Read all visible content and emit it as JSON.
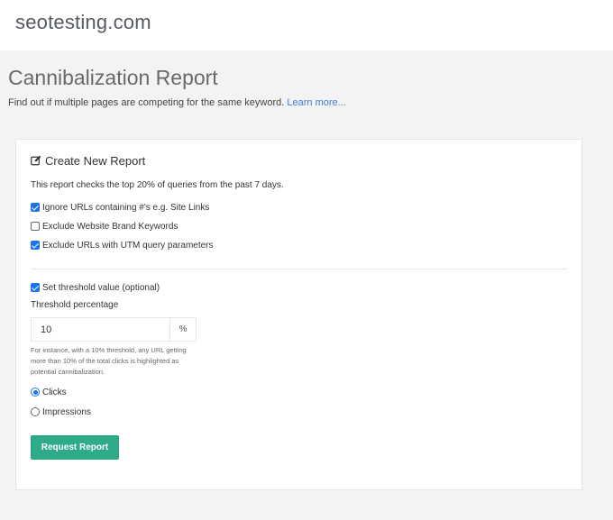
{
  "header": {
    "brand": "seotesting.com"
  },
  "page": {
    "title": "Cannibalization Report",
    "subtitle": "Find out if multiple pages are competing for the same keyword.",
    "learn_more": "Learn more..."
  },
  "form": {
    "card_title": "Create New Report",
    "description": "This report checks the top 20% of queries from the past 7 days.",
    "options": [
      {
        "label": "Ignore URLs containing #'s e.g. Site Links",
        "checked": true
      },
      {
        "label": "Exclude Website Brand Keywords",
        "checked": false
      },
      {
        "label": "Exclude URLs with UTM query parameters",
        "checked": true
      }
    ],
    "threshold_toggle": {
      "label": "Set threshold value (optional)",
      "checked": true
    },
    "threshold_label": "Threshold percentage",
    "threshold_value": "10",
    "threshold_unit": "%",
    "threshold_help": "For instance, with a 10% threshold, any URL getting more than 10% of the total clicks is highlighted as potential cannibalization.",
    "metric_options": [
      {
        "label": "Clicks",
        "selected": true
      },
      {
        "label": "Impressions",
        "selected": false
      }
    ],
    "submit_label": "Request Report"
  },
  "colors": {
    "accent": "#2eac8a",
    "link": "#3b7dd8",
    "checkbox": "#1a73e8"
  }
}
